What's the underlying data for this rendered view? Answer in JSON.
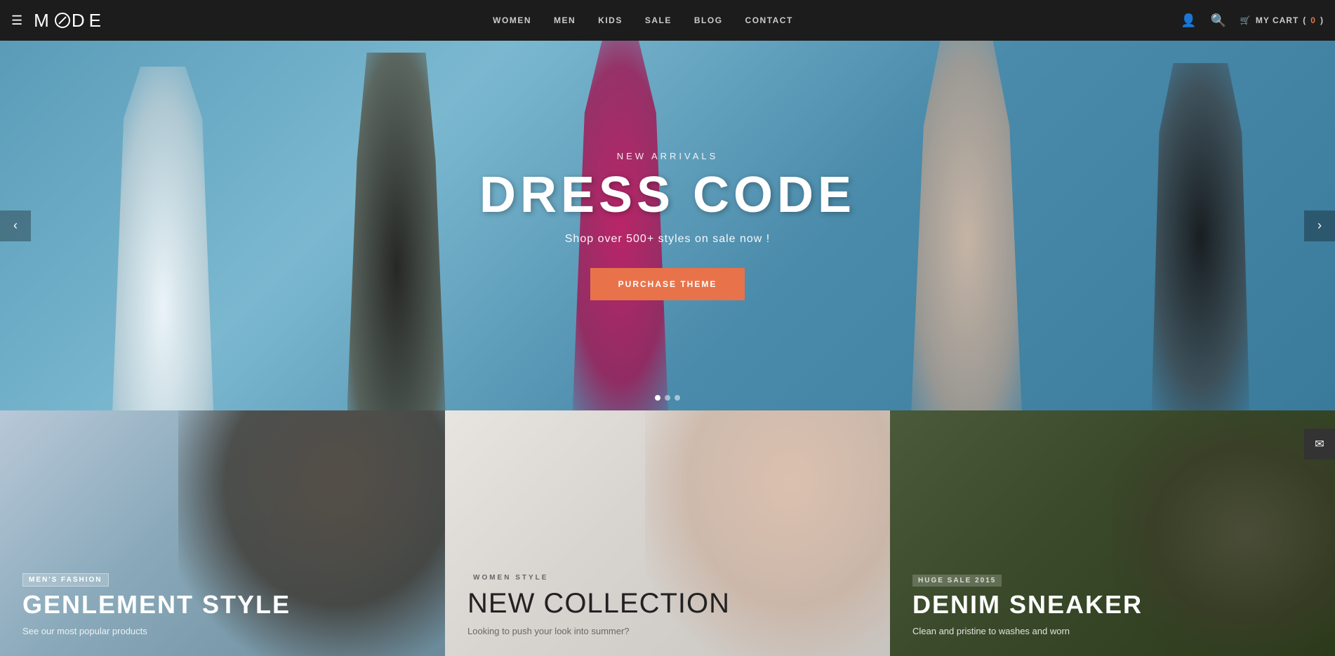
{
  "header": {
    "logo_text": "MODE",
    "hamburger_icon": "☰",
    "nav": [
      {
        "label": "WOMEN",
        "href": "#"
      },
      {
        "label": "MEN",
        "href": "#"
      },
      {
        "label": "KIDS",
        "href": "#"
      },
      {
        "label": "SALE",
        "href": "#"
      },
      {
        "label": "BLOG",
        "href": "#"
      },
      {
        "label": "CONTACT",
        "href": "#"
      }
    ],
    "account_icon": "👤",
    "search_icon": "🔍",
    "cart_icon": "🛒",
    "cart_label": "MY CART",
    "cart_count": "0"
  },
  "hero": {
    "subtitle": "NEW ARRIVALS",
    "title": "DRESS CODE",
    "description": "Shop over 500+ styles on sale now !",
    "cta_label": "PURCHASE THEME",
    "arrow_left": "‹",
    "arrow_right": "›"
  },
  "email_sidebar": {
    "icon": "✉"
  },
  "panels": [
    {
      "id": "men",
      "tag": "MEN'S FASHION",
      "title": "GENLEMENT STYLE",
      "description": "See our most popular products"
    },
    {
      "id": "women",
      "tag": "WOMEN STYLE",
      "title": "NEW COLLECTION",
      "description": "Looking to push your look into summer?"
    },
    {
      "id": "denim",
      "tag": "HUGE SALE 2015",
      "title": "DENIM SNEAKER",
      "description": "Clean and pristine to washes and worn"
    }
  ]
}
